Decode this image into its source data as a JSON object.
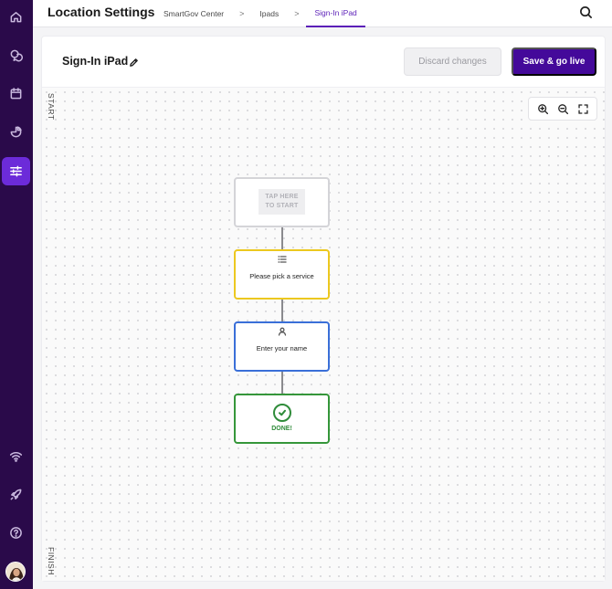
{
  "header": {
    "title": "Location Settings",
    "breadcrumbs": [
      "SmartGov Center",
      "Ipads",
      "Sign-In iPad"
    ],
    "separator": ">"
  },
  "sidebar": {
    "items": [
      {
        "icon": "home-icon",
        "active": false
      },
      {
        "icon": "chat-icon",
        "active": false
      },
      {
        "icon": "calendar-icon",
        "active": false
      },
      {
        "icon": "pie-chart-icon",
        "active": false
      },
      {
        "icon": "sliders-icon",
        "active": true
      },
      {
        "icon": "wifi-icon",
        "active": false
      },
      {
        "icon": "rocket-icon",
        "active": false
      },
      {
        "icon": "help-icon",
        "active": false
      }
    ]
  },
  "editor": {
    "flow_name": "Sign-In iPad",
    "discard_label": "Discard changes",
    "save_label": "Save & go live",
    "start_label": "START",
    "finish_label": "FINISH"
  },
  "nodes": {
    "start": {
      "line1": "TAP HERE",
      "line2": "TO START"
    },
    "service": {
      "label": "Please pick a service",
      "icon": "list-icon"
    },
    "name": {
      "label": "Enter your name",
      "icon": "user-icon"
    },
    "done": {
      "label": "DONE!",
      "icon": "check-circle-icon"
    }
  },
  "colors": {
    "sidebar_bg": "#2a0a4a",
    "active_accent": "#6c2bd9",
    "primary_button": "#44099a",
    "service_border": "#ecc81f",
    "name_border": "#3a6fd8",
    "done_border": "#35963a"
  }
}
